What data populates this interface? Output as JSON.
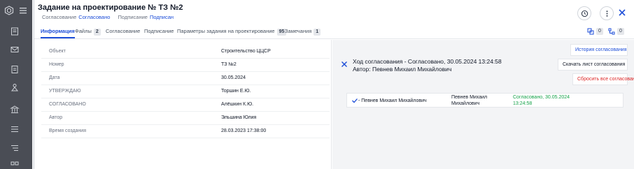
{
  "window": {
    "title": "Задание на проектирование № ТЗ №2",
    "status": [
      {
        "label": "Согласование",
        "value": "Согласовано"
      },
      {
        "label": "Подписание",
        "value": "Подписан"
      }
    ]
  },
  "icons": {
    "logo": "hexagon-logo-icon",
    "menu": "hamburger-menu-icon",
    "history": "history-clock-icon",
    "more": "vertical-dots-icon",
    "close": "close-icon"
  },
  "tabs": [
    {
      "label": "Информация",
      "badge": ""
    },
    {
      "label": "Файлы",
      "badge": "2"
    },
    {
      "label": "Согласование",
      "badge": ""
    },
    {
      "label": "Подписание",
      "badge": ""
    },
    {
      "label": "Параметры задания на проектирование",
      "badge": "95"
    },
    {
      "label": "Замечания",
      "badge": "1"
    }
  ],
  "tab_right": [
    {
      "icon": "link-icon",
      "count": "0"
    },
    {
      "icon": "tree-icon",
      "count": "0"
    }
  ],
  "info_rows": [
    {
      "key": "Объект",
      "value": "Строительство ЦЦСР"
    },
    {
      "key": "Номер",
      "value": "ТЗ №2"
    },
    {
      "key": "Дата",
      "value": "30.05.2024"
    },
    {
      "key": "УТВЕРЖДАЮ",
      "value": "Торшин Е.Ю."
    },
    {
      "key": "СОГЛАСОВАНО",
      "value": "Алёшкин К.Ю."
    },
    {
      "key": "Автор",
      "value": "Эльшина Юлия"
    },
    {
      "key": "Время создания",
      "value": "28.03.2023 17:38:00"
    }
  ],
  "approval": {
    "title": "Ход согласования - Согласовано, 30.05.2024 13:24:58",
    "author": "Автор: Певнев Михаил Михайлович",
    "history_button": "История согласования",
    "download_button": "Скачать лист согласования",
    "reset_button": "Сбросить все согласования",
    "row": {
      "name": "- Певнев Михаил Михайлович",
      "name2": "Певнев Михаил Михайлович",
      "status": "Согласовано, 30.05.2024 13:24:58"
    }
  },
  "colors": {
    "accent": "#1d4ed8",
    "approved": "#16a34a",
    "danger": "#dc2626",
    "sidebar": "#4a4d55"
  }
}
